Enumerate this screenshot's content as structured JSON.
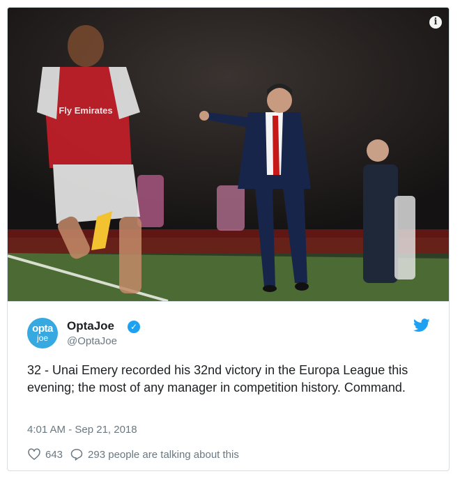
{
  "tweet": {
    "avatar": {
      "line1": "opta",
      "line2": "joe"
    },
    "display_name": "OptaJoe",
    "handle": "@OptaJoe",
    "text": "32 - Unai Emery recorded his 32nd victory in the Europa League this evening; the most of any manager in competition history. Command.",
    "timestamp": "4:01 AM - Sep 21, 2018",
    "likes": "643",
    "talking": "293 people are talking about this"
  },
  "media": {
    "shirt_sponsor": "Fly Emirates",
    "info_glyph": "i"
  },
  "icons": {
    "verified": "verified-badge-icon",
    "bird": "twitter-bird-icon",
    "like": "heart-icon",
    "reply": "speech-bubble-icon"
  },
  "colors": {
    "brand_blue": "#1da1f2",
    "avatar_blue": "#36a9e1",
    "text": "#1c2022",
    "muted": "#697882"
  }
}
